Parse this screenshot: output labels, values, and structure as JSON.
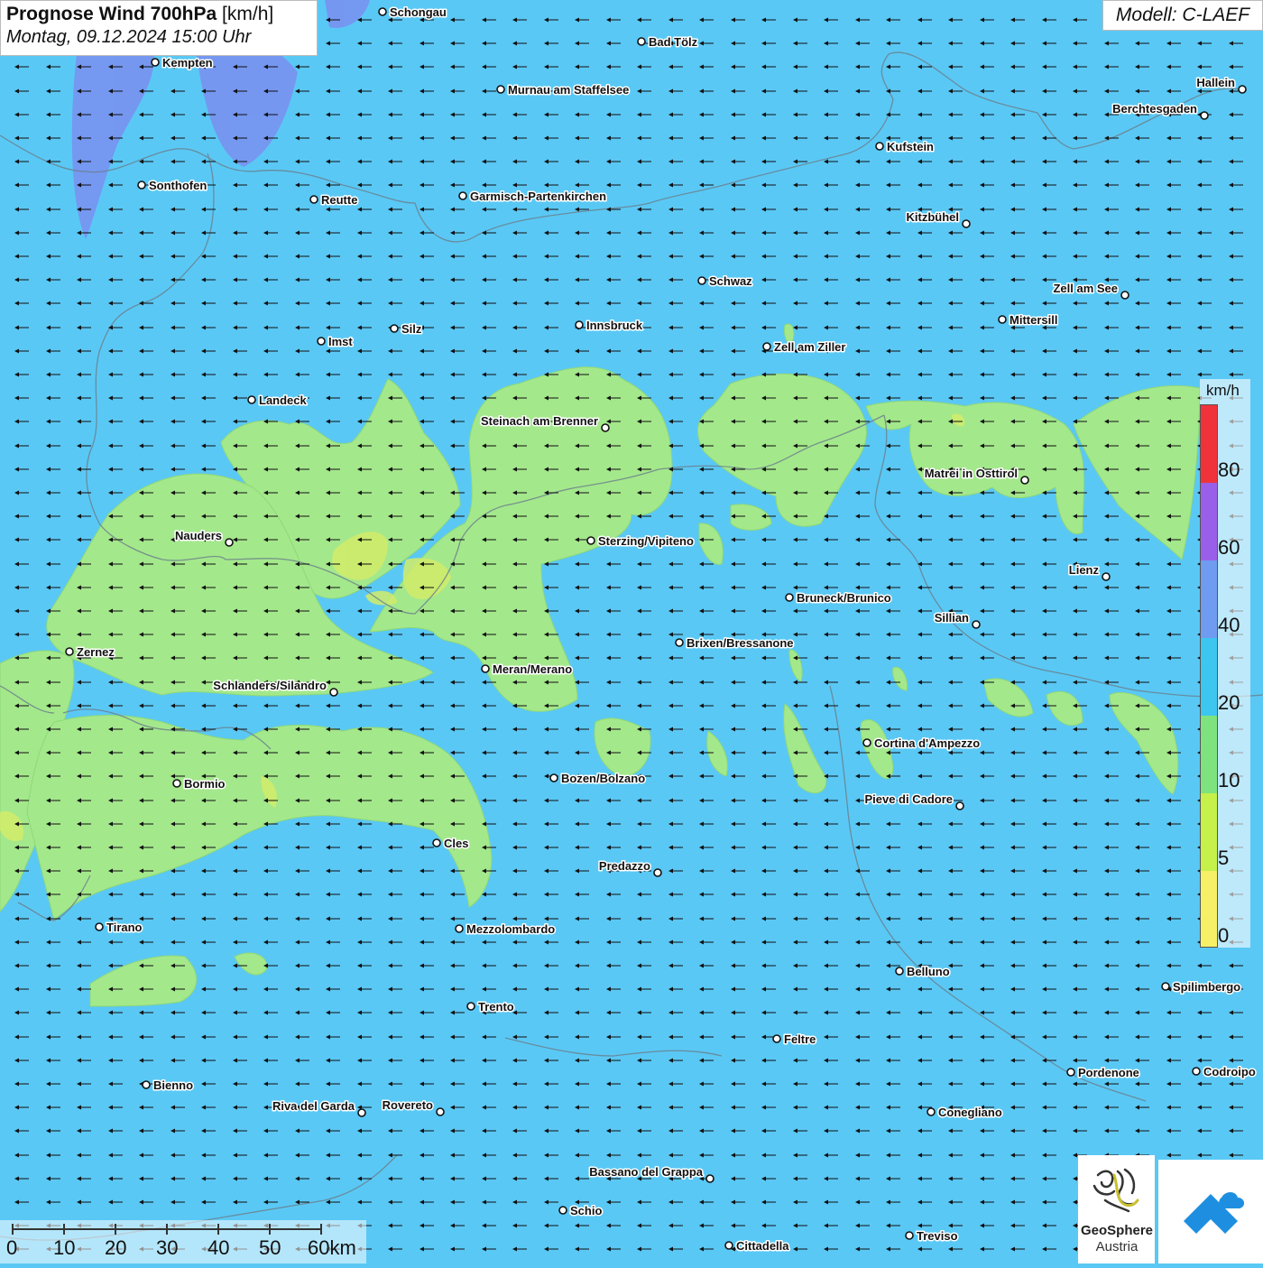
{
  "header": {
    "title_bold": "Prognose Wind 700hPa",
    "title_unit": "[km/h]",
    "subtitle": "Montag, 09.12.2024 15:00 Uhr",
    "model": "Modell: C-LAEF"
  },
  "legend": {
    "unit": "km/h",
    "labels": [
      "80",
      "60",
      "40",
      "20",
      "10",
      "5",
      "0"
    ],
    "colors": [
      "#f0333a",
      "#9a5fe8",
      "#6f9cf0",
      "#3cc6f0",
      "#7ee37e",
      "#c6f04a",
      "#f5f066"
    ]
  },
  "scale": {
    "labels": [
      "0",
      "10",
      "20",
      "30",
      "40",
      "50",
      "60km"
    ]
  },
  "logo": {
    "line1": "GeoSphere",
    "line2": "Austria"
  },
  "colors": {
    "background": "#5ac8f5",
    "calm_zone": "#a4e88c",
    "strong_zone": "#7a8ff0"
  },
  "wind": {
    "prevailing_direction": "east-to-west"
  },
  "cities": [
    {
      "name": "Schongau"
    },
    {
      "name": "Bad Tölz"
    },
    {
      "name": "Kempten"
    },
    {
      "name": "Murnau am Staffelsee"
    },
    {
      "name": "Hallein"
    },
    {
      "name": "Berchtesgaden"
    },
    {
      "name": "Kufstein"
    },
    {
      "name": "Sonthofen"
    },
    {
      "name": "Reutte"
    },
    {
      "name": "Garmisch-Partenkirchen"
    },
    {
      "name": "Kitzbühel"
    },
    {
      "name": "Schwaz"
    },
    {
      "name": "Zell am See"
    },
    {
      "name": "Mittersill"
    },
    {
      "name": "Imst"
    },
    {
      "name": "Silz"
    },
    {
      "name": "Innsbruck"
    },
    {
      "name": "Zell am Ziller"
    },
    {
      "name": "Landeck"
    },
    {
      "name": "Steinach am Brenner"
    },
    {
      "name": "Matrei in Osttirol"
    },
    {
      "name": "Nauders"
    },
    {
      "name": "Sterzing/Vipiteno"
    },
    {
      "name": "Lienz"
    },
    {
      "name": "Bruneck/Brunico"
    },
    {
      "name": "Sillian"
    },
    {
      "name": "Zernez"
    },
    {
      "name": "Brixen/Bressanone"
    },
    {
      "name": "Meran/Merano"
    },
    {
      "name": "Schlanders/Silandro"
    },
    {
      "name": "Cortina d'Ampezzo"
    },
    {
      "name": "Bozen/Bolzano"
    },
    {
      "name": "Bormio"
    },
    {
      "name": "Pieve di Cadore"
    },
    {
      "name": "Cles"
    },
    {
      "name": "Predazzo"
    },
    {
      "name": "Tirano"
    },
    {
      "name": "Mezzolombardo"
    },
    {
      "name": "Belluno"
    },
    {
      "name": "Spilimbergo"
    },
    {
      "name": "Trento"
    },
    {
      "name": "Feltre"
    },
    {
      "name": "Pordenone"
    },
    {
      "name": "Codroipo"
    },
    {
      "name": "Bienno"
    },
    {
      "name": "Riva del Garda"
    },
    {
      "name": "Rovereto"
    },
    {
      "name": "Conegliano"
    },
    {
      "name": "Bassano del Grappa"
    },
    {
      "name": "Schio"
    },
    {
      "name": "Treviso"
    },
    {
      "name": "Cittadella"
    }
  ]
}
